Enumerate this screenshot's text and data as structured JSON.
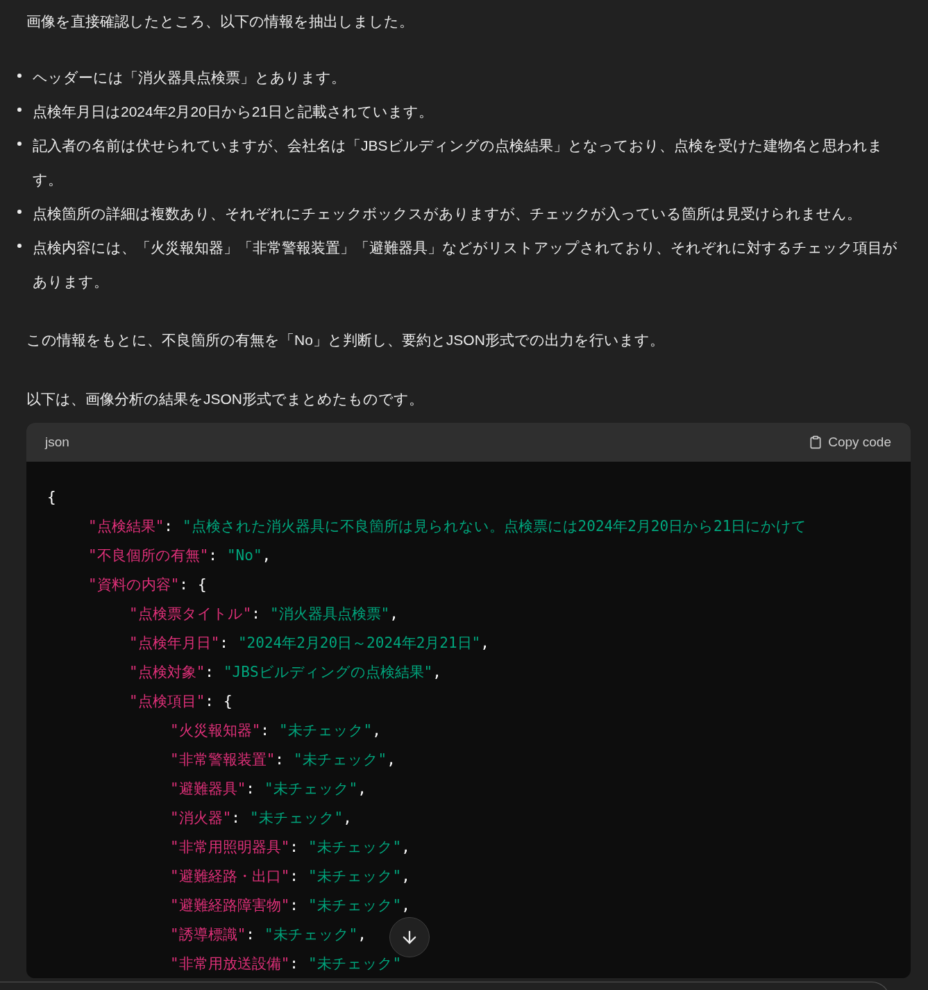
{
  "message": {
    "intro": "画像を直接確認したところ、以下の情報を抽出しました。",
    "bullets": [
      {
        "text": "ヘッダーには「消火器具点検票」とあります。"
      },
      {
        "text": "点検年月日は2024年2月20日から21日と記載されています。"
      },
      {
        "text": "記入者の名前は伏せられていますが、会社名は「JBSビルディングの点検結果」となっており、点検を受けた建物名と思われます。"
      },
      {
        "text": "点検箇所の詳細は複数あり、それぞれにチェックボックスがありますが、チェックが入っている箇所は見受けられません。"
      },
      {
        "text": "点検内容には、「火災報知器」「非常警報装置」「避難器具」などがリストアップされており、それぞれに対するチェック項目があります。"
      }
    ],
    "paragraphs": [
      "この情報をもとに、不良箇所の有無を「No」と判断し、要約とJSON形式での出力を行います。",
      "以下は、画像分析の結果をJSON形式でまとめたものです。"
    ],
    "code_block": {
      "language": "json",
      "copy_label": "Copy code",
      "open": "{",
      "entries": [
        {
          "key": "\"点検結果\"",
          "colon": ":",
          "value": "\"点検された消火器具に不良箇所は見られない。点検票には2024年2月20日から21日にかけて"
        },
        {
          "key": "\"不良個所の有無\"",
          "colon": ":",
          "value": "\"No\"",
          "comma": ","
        },
        {
          "key": "\"資料の内容\"",
          "colon": ":",
          "open": "{",
          "children": [
            {
              "key": "\"点検票タイトル\"",
              "colon": ":",
              "value": "\"消火器具点検票\"",
              "comma": ","
            },
            {
              "key": "\"点検年月日\"",
              "colon": ":",
              "value": "\"2024年2月20日～2024年2月21日\"",
              "comma": ","
            },
            {
              "key": "\"点検対象\"",
              "colon": ":",
              "value": "\"JBSビルディングの点検結果\"",
              "comma": ","
            },
            {
              "key": "\"点検項目\"",
              "colon": ":",
              "open": "{",
              "children": [
                {
                  "key": "\"火災報知器\"",
                  "colon": ":",
                  "value": "\"未チェック\"",
                  "comma": ","
                },
                {
                  "key": "\"非常警報装置\"",
                  "colon": ":",
                  "value": "\"未チェック\"",
                  "comma": ","
                },
                {
                  "key": "\"避難器具\"",
                  "colon": ":",
                  "value": "\"未チェック\"",
                  "comma": ","
                },
                {
                  "key": "\"消火器\"",
                  "colon": ":",
                  "value": "\"未チェック\"",
                  "comma": ","
                },
                {
                  "key": "\"非常用照明器具\"",
                  "colon": ":",
                  "value": "\"未チェック\"",
                  "comma": ","
                },
                {
                  "key": "\"避難経路・出口\"",
                  "colon": ":",
                  "value": "\"未チェック\"",
                  "comma": ","
                },
                {
                  "key": "\"避難経路障害物\"",
                  "colon": ":",
                  "value": "\"未チェック\"",
                  "comma": ","
                },
                {
                  "key": "\"誘導標識\"",
                  "colon": ":",
                  "value": "\"未チェック\"",
                  "comma": ","
                },
                {
                  "key": "\"非常用放送設備\"",
                  "colon": ":",
                  "value": "\"未チェック\""
                }
              ]
            }
          ]
        }
      ]
    }
  }
}
